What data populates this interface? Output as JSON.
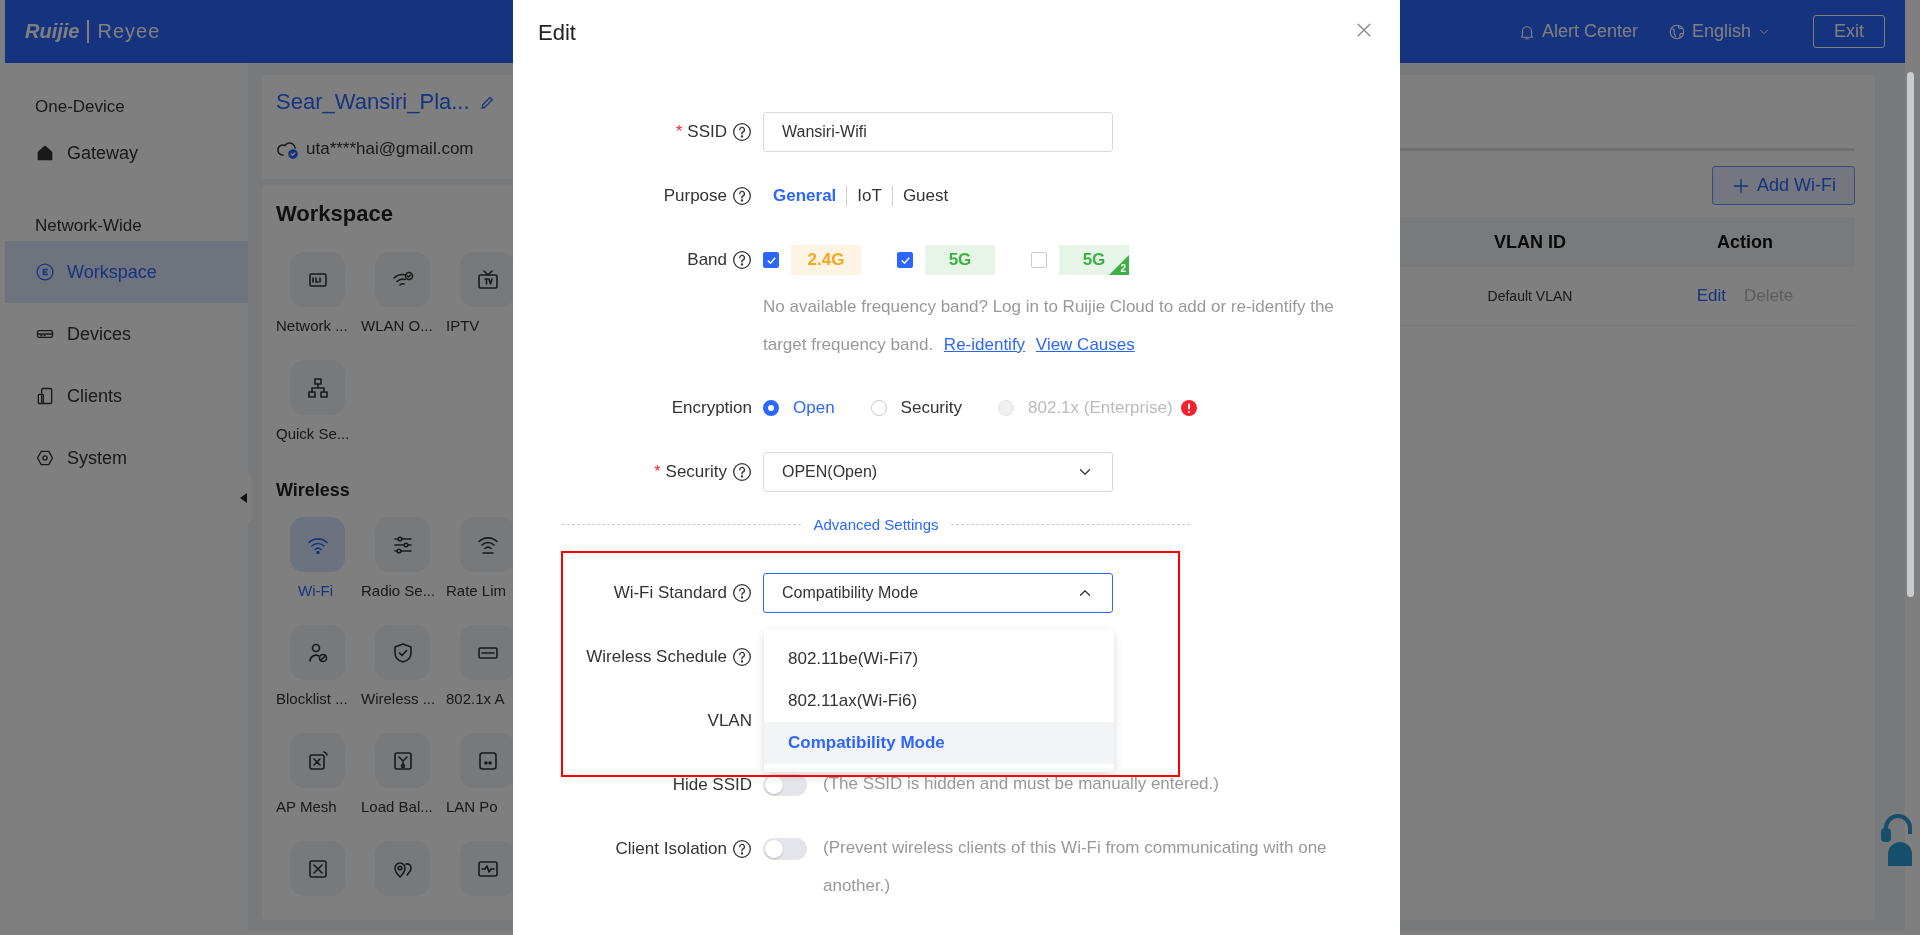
{
  "header": {
    "logo": [
      "Ruijie",
      "Reyee"
    ],
    "alert_center": "Alert Center",
    "language": "English",
    "exit": "Exit"
  },
  "sidebar": {
    "sections": [
      {
        "title": "One-Device",
        "items": [
          {
            "label": "Gateway",
            "selected": false
          }
        ]
      },
      {
        "title": "Network-Wide",
        "items": [
          {
            "label": "Workspace",
            "selected": true
          },
          {
            "label": "Devices",
            "selected": false
          },
          {
            "label": "Clients",
            "selected": false
          },
          {
            "label": "System",
            "selected": false
          }
        ]
      }
    ]
  },
  "device": {
    "name": "Sear_Wansiri_Pla...",
    "account": "uta****hai@gmail.com"
  },
  "workspace": {
    "title": "Workspace",
    "tiles": [
      {
        "label": "Network ...",
        "selected": false
      },
      {
        "label": "WLAN O...",
        "selected": false
      },
      {
        "label": "IPTV",
        "selected": false
      },
      {
        "label": "Quick Se...",
        "selected": false
      }
    ],
    "wireless": {
      "title": "Wireless",
      "tiles": [
        {
          "label": "Wi-Fi",
          "selected": true
        },
        {
          "label": "Radio Se...",
          "selected": false
        },
        {
          "label": "Rate Lim",
          "selected": false
        },
        {
          "label": "Blocklist ...",
          "selected": false
        },
        {
          "label": "Wireless ...",
          "selected": false
        },
        {
          "label": "802.1x A",
          "selected": false
        },
        {
          "label": "AP Mesh",
          "selected": false
        },
        {
          "label": "Load Bal...",
          "selected": false
        },
        {
          "label": "LAN Po",
          "selected": false
        },
        {
          "selected": false
        },
        {
          "selected": false
        },
        {
          "selected": false
        }
      ]
    }
  },
  "wifi_table": {
    "add_button": "Add Wi-Fi",
    "columns": [
      "VLAN ID",
      "Action"
    ],
    "rows": [
      {
        "vlan_id": "Default VLAN",
        "actions": [
          {
            "label": "Edit",
            "disabled": false
          },
          {
            "label": "Delete",
            "disabled": true
          }
        ]
      }
    ]
  },
  "dialog": {
    "title": "Edit",
    "fields": [
      {
        "kind": "input",
        "required_mark": "*",
        "label": "SSID",
        "help": true,
        "value": "Wansiri-Wifi"
      },
      {
        "kind": "segmented",
        "label": "Purpose",
        "help": true,
        "options": [
          {
            "label": "General",
            "selected": true
          },
          {
            "label": "IoT",
            "selected": false
          },
          {
            "label": "Guest",
            "selected": false
          }
        ]
      },
      {
        "kind": "bands",
        "label": "Band",
        "help": true,
        "options": [
          {
            "label": "2.4G",
            "checked": true,
            "color": "#f5a623"
          },
          {
            "label": "5G",
            "checked": true,
            "color": "#3cb043"
          },
          {
            "label": "5G",
            "checked": false,
            "color": "#3cb043",
            "badge": "2"
          }
        ],
        "note": "No available frequency band? Log in to Ruijie Cloud to add or re-identify the target frequency band.",
        "links": [
          "Re-identify",
          "View Causes"
        ]
      },
      {
        "kind": "radios",
        "label": "Encryption",
        "help": false,
        "options": [
          {
            "label": "Open",
            "selected": true,
            "disabled": false,
            "warning": false
          },
          {
            "label": "Security",
            "selected": false,
            "disabled": false,
            "warning": false
          },
          {
            "label": "802.1x (Enterprise)",
            "selected": false,
            "disabled": true,
            "warning": true
          }
        ]
      },
      {
        "kind": "select",
        "required_mark": "*",
        "label": "Security",
        "help": true,
        "value": "OPEN(Open)",
        "expanded": false
      },
      {
        "kind": "divider",
        "label": "Advanced Settings"
      },
      {
        "kind": "select",
        "label": "Wi-Fi Standard",
        "help": true,
        "value": "Compatibility Mode",
        "expanded": true,
        "options": [
          {
            "label": "802.11be(Wi-Fi7)",
            "selected": false
          },
          {
            "label": "802.11ax(Wi-Fi6)",
            "selected": false
          },
          {
            "label": "Compatibility Mode",
            "selected": true
          }
        ]
      },
      {
        "kind": "empty",
        "label": "Wireless Schedule",
        "help": true
      },
      {
        "kind": "empty",
        "label": "VLAN",
        "help": false
      },
      {
        "kind": "toggle",
        "label": "Hide SSID",
        "help": false,
        "on": false,
        "description": "(The SSID is hidden and must be manually entered.)"
      },
      {
        "kind": "toggle",
        "label": "Client Isolation",
        "help": true,
        "on": false,
        "description": "(Prevent wireless clients of this Wi-Fi from communicating with one another.)"
      }
    ]
  }
}
